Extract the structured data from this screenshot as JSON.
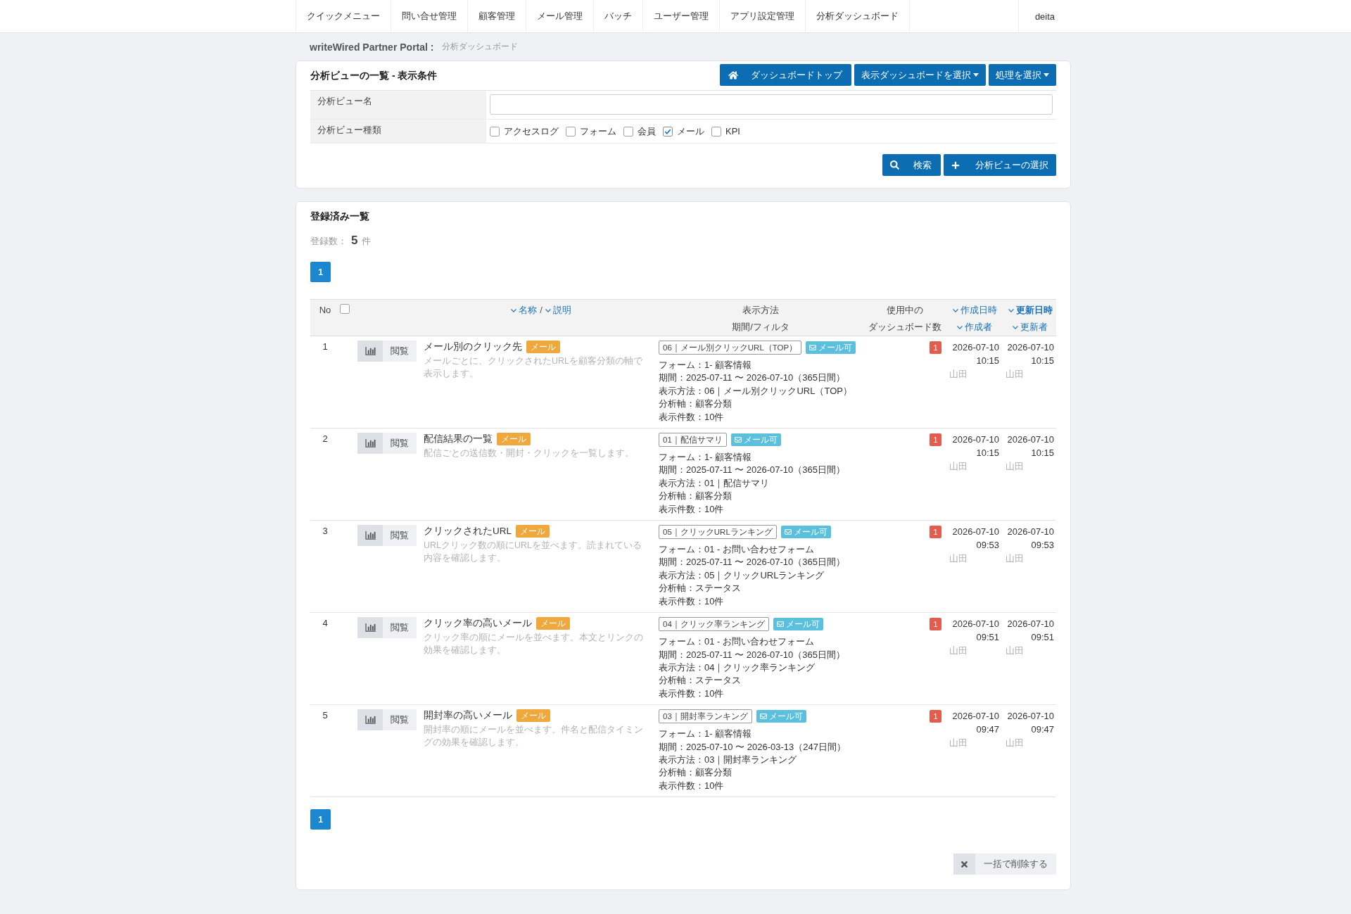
{
  "nav": {
    "items": [
      "クイックメニュー",
      "問い合せ管理",
      "顧客管理",
      "メール管理",
      "バッチ",
      "ユーザー管理",
      "アプリ設定管理",
      "分析ダッシュボード"
    ],
    "user": "deita"
  },
  "breadcrumb": {
    "site": "writeWired Partner Portal :",
    "page": "分析ダッシュボード"
  },
  "filter_panel": {
    "title": "分析ビューの一覧 - 表示条件",
    "buttons": [
      {
        "kind": "home",
        "label": "ダッシュボードトップ"
      },
      {
        "kind": "dropdown",
        "label": "表示ダッシュボードを選択"
      },
      {
        "kind": "dropdown",
        "label": "処理を選択"
      }
    ],
    "fields": [
      {
        "kind": "text",
        "label": "分析ビュー名"
      },
      {
        "kind": "checkboxes",
        "label": "分析ビュー種類",
        "options": [
          {
            "label": "アクセスログ",
            "checked": false
          },
          {
            "label": "フォーム",
            "checked": false
          },
          {
            "label": "会員",
            "checked": false
          },
          {
            "label": "メール",
            "checked": true
          },
          {
            "label": "KPI",
            "checked": false
          }
        ]
      }
    ],
    "actions": [
      {
        "kind": "search",
        "label": "検索"
      },
      {
        "kind": "add",
        "label": "分析ビューの選択"
      }
    ]
  },
  "list_panel": {
    "title": "登録済み一覧",
    "count": {
      "label": "登録数：",
      "value": "5",
      "unit": "件"
    },
    "pagination_top": [
      {
        "label": "1",
        "selected": true
      }
    ],
    "table": {
      "header": {
        "no": "No",
        "select_all": {
          "checked": false
        },
        "name_sort": {
          "links": [
            {
              "label": "名称",
              "selected": false
            },
            {
              "label": "説明",
              "selected": false
            }
          ],
          "separator": "/"
        },
        "method": [
          "表示方法",
          "期間/フィルタ"
        ],
        "dashboards": [
          "使用中の",
          "ダッシュボード数"
        ],
        "created": [
          {
            "label": "作成日時",
            "selected": false
          },
          {
            "label": "作成者",
            "selected": false
          }
        ],
        "updated": [
          {
            "label": "更新日時",
            "selected": true
          },
          {
            "label": "更新者",
            "selected": false
          }
        ]
      },
      "rows": [
        {
          "no": "1",
          "view_label": "閲覧",
          "name": "メール別のクリック先",
          "tag": "メール",
          "description": "メールごとに、クリックされたURLを顧客分類の軸で表示します。",
          "code": "06｜メール別クリックURL（TOP）",
          "permission": "メール可",
          "details": [
            "フォーム：1- 顧客情報",
            "期間：2025-07-11 〜 2026-07-10（365日間）",
            "表示方法：06｜メール別クリックURL（TOP）",
            "分析軸：顧客分類",
            "表示件数：10件"
          ],
          "dashboards": "1",
          "created": {
            "date": "2026-07-10",
            "time": "10:15",
            "by": "山田"
          },
          "updated": {
            "date": "2026-07-10",
            "time": "10:15",
            "by": "山田"
          }
        },
        {
          "no": "2",
          "view_label": "閲覧",
          "name": "配信結果の一覧",
          "tag": "メール",
          "description": "配信ごとの送信数・開封・クリックを一覧します。",
          "code": "01｜配信サマリ",
          "permission": "メール可",
          "details": [
            "フォーム：1- 顧客情報",
            "期間：2025-07-11 〜 2026-07-10（365日間）",
            "表示方法：01｜配信サマリ",
            "分析軸：顧客分類",
            "表示件数：10件"
          ],
          "dashboards": "1",
          "created": {
            "date": "2026-07-10",
            "time": "10:15",
            "by": "山田"
          },
          "updated": {
            "date": "2026-07-10",
            "time": "10:15",
            "by": "山田"
          }
        },
        {
          "no": "3",
          "view_label": "閲覧",
          "name": "クリックされたURL",
          "tag": "メール",
          "description": "URLクリック数の順にURLを並べます。読まれている内容を確認します。",
          "code": "05｜クリックURLランキング",
          "permission": "メール可",
          "details": [
            "フォーム：01 - お問い合わせフォーム",
            "期間：2025-07-11 〜 2026-07-10（365日間）",
            "表示方法：05｜クリックURLランキング",
            "分析軸：ステータス",
            "表示件数：10件"
          ],
          "dashboards": "1",
          "created": {
            "date": "2026-07-10",
            "time": "09:53",
            "by": "山田"
          },
          "updated": {
            "date": "2026-07-10",
            "time": "09:53",
            "by": "山田"
          }
        },
        {
          "no": "4",
          "view_label": "閲覧",
          "name": "クリック率の高いメール",
          "tag": "メール",
          "description": "クリック率の順にメールを並べます。本文とリンクの効果を確認します。",
          "code": "04｜クリック率ランキング",
          "permission": "メール可",
          "details": [
            "フォーム：01 - お問い合わせフォーム",
            "期間：2025-07-11 〜 2026-07-10（365日間）",
            "表示方法：04｜クリック率ランキング",
            "分析軸：ステータス",
            "表示件数：10件"
          ],
          "dashboards": "1",
          "created": {
            "date": "2026-07-10",
            "time": "09:51",
            "by": "山田"
          },
          "updated": {
            "date": "2026-07-10",
            "time": "09:51",
            "by": "山田"
          }
        },
        {
          "no": "5",
          "view_label": "閲覧",
          "name": "開封率の高いメール",
          "tag": "メール",
          "description": "開封率の順にメールを並べます。件名と配信タイミングの効果を確認します。",
          "code": "03｜開封率ランキング",
          "permission": "メール可",
          "details": [
            "フォーム：1- 顧客情報",
            "期間：2025-07-10 〜 2026-03-13（247日間）",
            "表示方法：03｜開封率ランキング",
            "分析軸：顧客分類",
            "表示件数：10件"
          ],
          "dashboards": "1",
          "created": {
            "date": "2026-07-10",
            "time": "09:47",
            "by": "山田"
          },
          "updated": {
            "date": "2026-07-10",
            "time": "09:47",
            "by": "山田"
          }
        }
      ]
    },
    "pagination_bottom": [
      {
        "label": "1",
        "selected": true
      }
    ],
    "bulk_delete": "一括で削除する"
  }
}
